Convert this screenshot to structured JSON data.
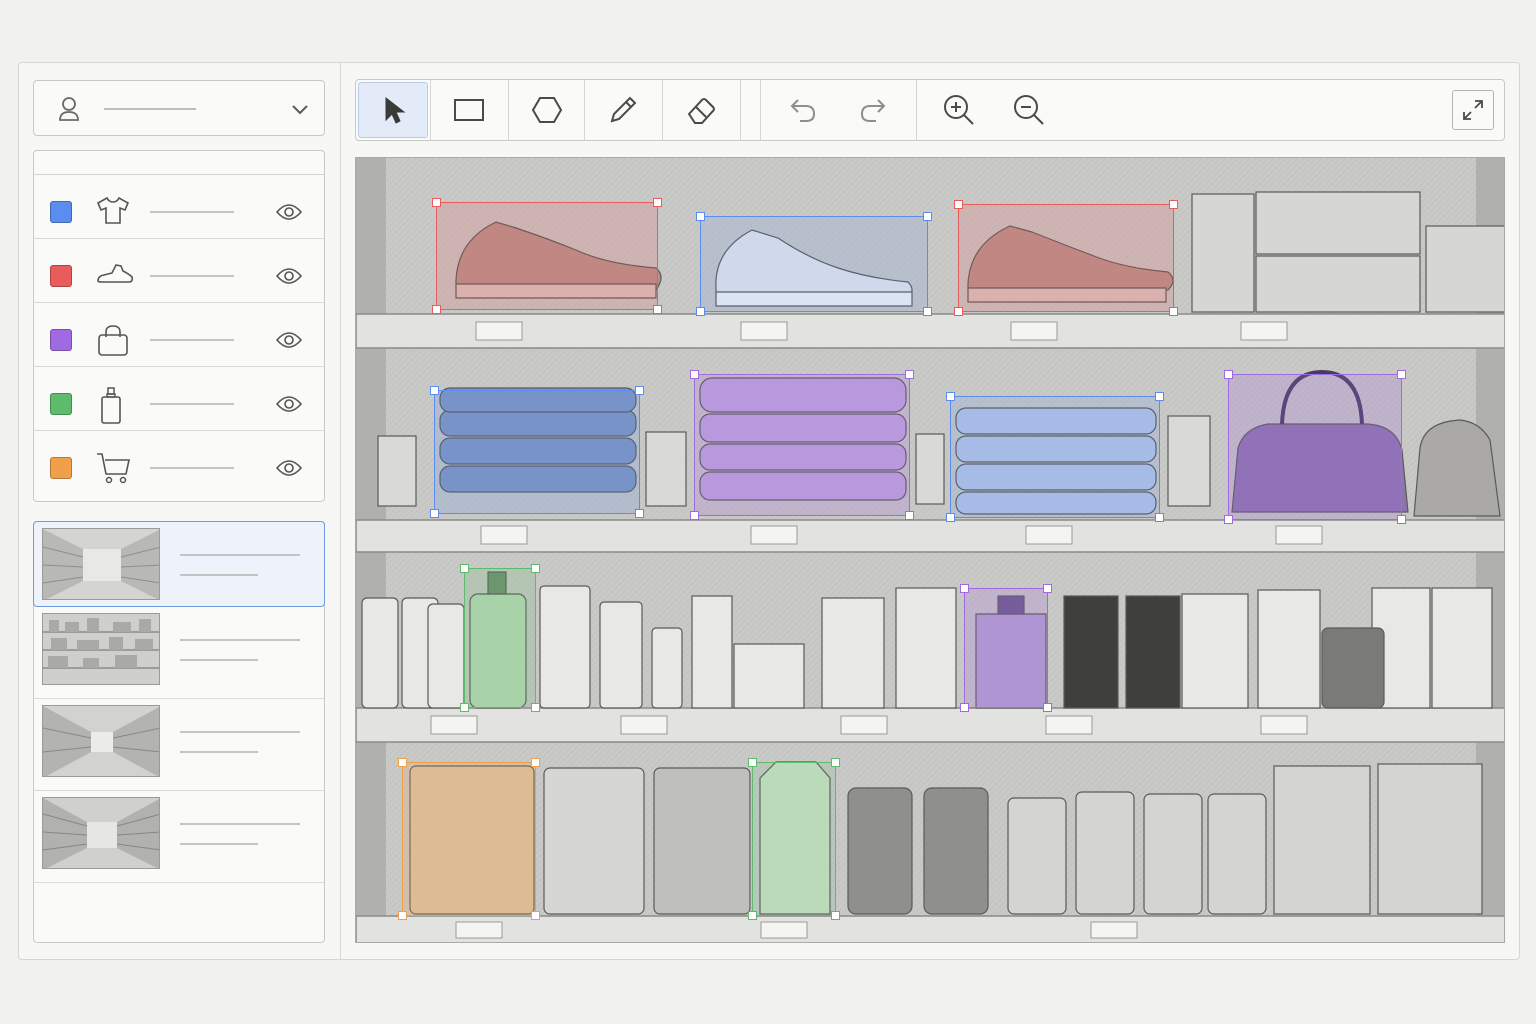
{
  "colors": {
    "accent": "#5b8def",
    "classes": {
      "clothing": "#5b8def",
      "shoes": "#e85c5c",
      "bags": "#a06be0",
      "cosmetics": "#5dbb6b",
      "grocery": "#f0a04b"
    }
  },
  "user_menu": {
    "icon": "user-icon",
    "chevron": "chevron-down-icon"
  },
  "labels": [
    {
      "class": "clothing",
      "icon": "tshirt-icon",
      "color": "#5b8def"
    },
    {
      "class": "shoes",
      "icon": "shoe-icon",
      "color": "#e85c5c"
    },
    {
      "class": "bags",
      "icon": "bag-icon",
      "color": "#a06be0"
    },
    {
      "class": "cosmetics",
      "icon": "bottle-icon",
      "color": "#5dbb6b"
    },
    {
      "class": "grocery",
      "icon": "cart-icon",
      "color": "#f0a04b"
    }
  ],
  "toolbar": {
    "tools": [
      "select-tool",
      "rectangle-tool",
      "polygon-tool",
      "pencil-tool",
      "eraser-tool",
      "undo",
      "redo",
      "zoom-in",
      "zoom-out",
      "fullscreen"
    ],
    "active_tool": "select-tool"
  },
  "thumbnails": {
    "count": 4,
    "active_index": 0
  },
  "annotations": [
    {
      "class": "shoes",
      "color": "#e85c5c"
    },
    {
      "class": "clothing",
      "color": "#5b8def"
    },
    {
      "class": "shoes",
      "color": "#e85c5c"
    },
    {
      "class": "clothing",
      "color": "#5b8def"
    },
    {
      "class": "bags",
      "color": "#a06be0"
    },
    {
      "class": "clothing",
      "color": "#5b8def"
    },
    {
      "class": "bags",
      "color": "#a06be0"
    },
    {
      "class": "cosmetics",
      "color": "#5dbb6b"
    },
    {
      "class": "bags",
      "color": "#a06be0"
    },
    {
      "class": "grocery",
      "color": "#f0a04b"
    },
    {
      "class": "cosmetics",
      "color": "#5dbb6b"
    }
  ]
}
